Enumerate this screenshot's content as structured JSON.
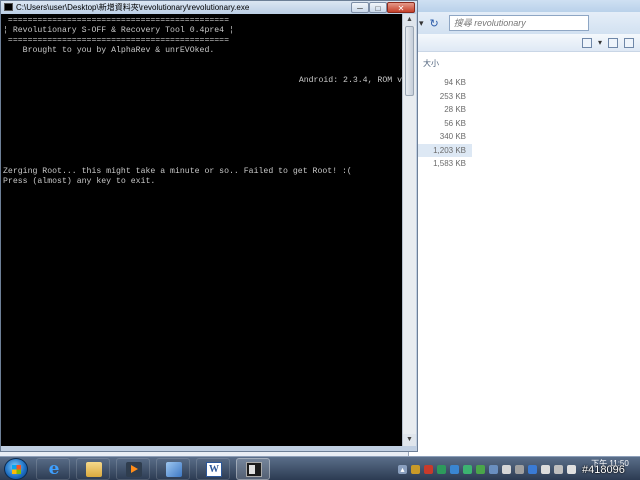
{
  "console_window": {
    "title": "C:\\Users\\user\\Desktop\\新增資料夾\\revolutionary\\revolutionary.exe",
    "minimize_glyph": "─",
    "maximize_glyph": "□",
    "close_glyph": "✕",
    "lines": [
      " =============================================",
      "¦ Revolutionary S-OFF & Recovery Tool 0.4pre4 ¦",
      " =============================================",
      "    Brought to you by AlphaRev & unrEVOked.",
      "Android: 2.3.4, ROM v",
      "Zerging Root... this might take a minute or so.. Failed to get Root! :(",
      "Press (almost) any key to exit."
    ],
    "scroll_up": "▲",
    "scroll_down": "▼"
  },
  "explorer_window": {
    "search_placeholder": "搜尋 revolutionary",
    "column_header": "大小",
    "file_sizes": [
      "94 KB",
      "253 KB",
      "28 KB",
      "56 KB",
      "340 KB",
      "1,203 KB",
      "1,583 KB"
    ],
    "selected_index": 5
  },
  "taskbar": {
    "time": "下午 11:50",
    "watermark": "#418096"
  },
  "colors": {
    "console_bg": "#000000",
    "console_text": "#c8c8c8",
    "taskbar": "#2c3b52"
  }
}
